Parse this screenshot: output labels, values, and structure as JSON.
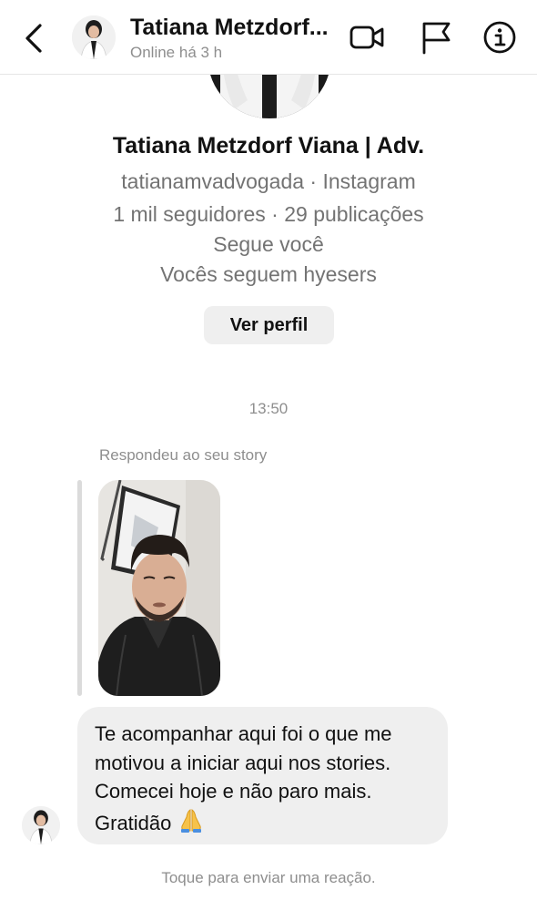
{
  "header": {
    "contact_name": "Tatiana Metzdorf...",
    "status": "Online há 3 h"
  },
  "profile": {
    "full_name": "Tatiana Metzdorf Viana | Adv.",
    "handle_line": "tatianamvadvogada · Instagram",
    "stats_line": "1 mil seguidores · 29 publicações",
    "follows_you": "Segue você",
    "mutual": "Vocês seguem hyesers",
    "view_profile_label": "Ver perfil"
  },
  "conversation": {
    "timestamp": "13:50",
    "story_reply_label": "Respondeu ao seu story",
    "message_text": "Te acompanhar aqui foi o que me\nmotivou a iniciar aqui nos stories.\nComecei hoje e não paro mais.\nGratidão ",
    "message_emoji": "praying-hands-icon",
    "reaction_hint": "Toque para enviar uma reação."
  },
  "icons": {
    "back": "chevron-left-icon",
    "video": "video-camera-icon",
    "report": "flag-icon",
    "info": "info-icon"
  },
  "colors": {
    "secondary_text": "#8e8e8e",
    "bubble_bg": "#efefef",
    "button_bg": "#efefef"
  }
}
